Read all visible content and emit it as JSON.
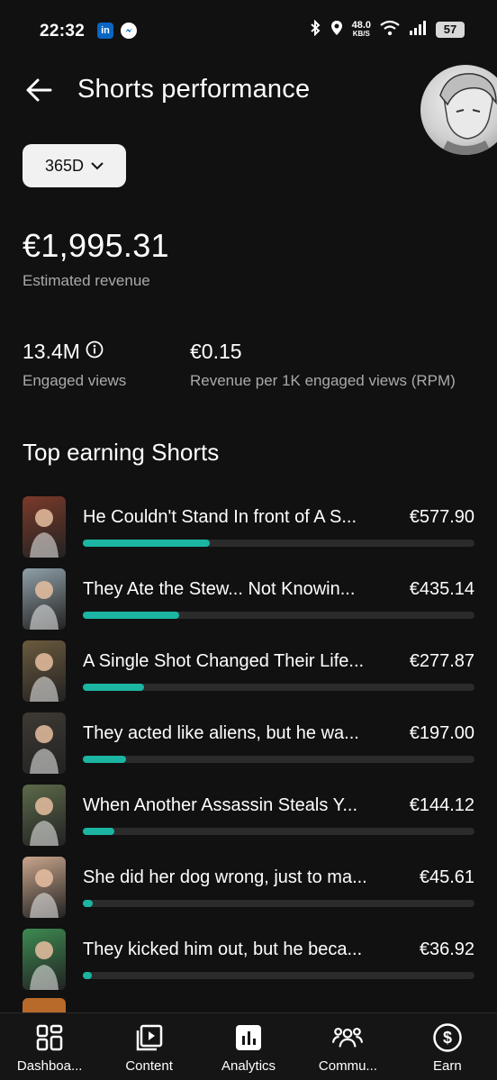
{
  "status_bar": {
    "time": "22:32",
    "speed_value": "48.0",
    "speed_unit": "KB/S",
    "battery": "57"
  },
  "header": {
    "title": "Shorts performance"
  },
  "range_selector": {
    "label": "365D"
  },
  "summary": {
    "revenue": "€1,995.31",
    "revenue_label": "Estimated revenue",
    "engaged_views": "13.4M",
    "engaged_views_label": "Engaged views",
    "rpm": "€0.15",
    "rpm_label": "Revenue per 1K engaged views (RPM)"
  },
  "top_shorts": {
    "title": "Top earning Shorts",
    "items": [
      {
        "title": "He Couldn't Stand In front of A S...",
        "value": "€577.90",
        "share": 0.325,
        "thumb_color": "#7a3a2a"
      },
      {
        "title": "They Ate the Stew... Not Knowin...",
        "value": "€435.14",
        "share": 0.245,
        "thumb_color": "#8fa0a8"
      },
      {
        "title": "A Single Shot Changed Their Life...",
        "value": "€277.87",
        "share": 0.156,
        "thumb_color": "#6b5a3e"
      },
      {
        "title": "They acted like aliens, but he wa...",
        "value": "€197.00",
        "share": 0.111,
        "thumb_color": "#3e3a34"
      },
      {
        "title": "When Another Assassin Steals Y...",
        "value": "€144.12",
        "share": 0.081,
        "thumb_color": "#5c6a4a"
      },
      {
        "title": "She did her dog wrong, just to ma...",
        "value": "€45.61",
        "share": 0.026,
        "thumb_color": "#c9a58c"
      },
      {
        "title": "They kicked him out, but he beca...",
        "value": "€36.92",
        "share": 0.021,
        "thumb_color": "#3d8a52"
      }
    ]
  },
  "bottom_nav": {
    "items": [
      {
        "label": "Dashboa...",
        "icon": "dashboard-icon"
      },
      {
        "label": "Content",
        "icon": "content-icon"
      },
      {
        "label": "Analytics",
        "icon": "analytics-icon"
      },
      {
        "label": "Commu...",
        "icon": "community-icon"
      },
      {
        "label": "Earn",
        "icon": "earn-icon"
      }
    ]
  },
  "colors": {
    "background": "#111111",
    "accent": "#1bb5a2",
    "muted_text": "#aaaaaa"
  }
}
